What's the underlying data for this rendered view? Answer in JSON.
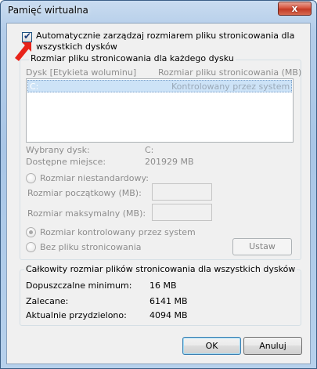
{
  "window": {
    "title": "Pamięć wirtualna",
    "close_label": "x"
  },
  "auto_manage": {
    "label": "Automatycznie zarządzaj rozmiarem pliku stronicowania dla wszystkich dysków",
    "checked": true
  },
  "per_drive": {
    "group_title": "Rozmiar pliku stronicowania dla każdego dysku",
    "col_drive": "Dysk [Etykieta woluminu]",
    "col_size": "Rozmiar pliku stronicowania (MB)",
    "rows": [
      {
        "drive": "C:",
        "size": "Kontrolowany przez system"
      }
    ],
    "selected_drive_label": "Wybrany dysk:",
    "selected_drive_value": "C:",
    "free_space_label": "Dostępne miejsce:",
    "free_space_value": "201929  MB",
    "custom_size_label": "Rozmiar niestandardowy:",
    "initial_size_label": "Rozmiar początkowy (MB):",
    "max_size_label": "Rozmiar maksymalny (MB):",
    "system_managed_label": "Rozmiar kontrolowany przez system",
    "no_paging_label": "Bez pliku stronicowania",
    "set_button": "Ustaw"
  },
  "totals": {
    "group_title": "Całkowity rozmiar plików stronicowania dla wszystkich dysków",
    "min_label": "Dopuszczalne minimum:",
    "min_value": "16  MB",
    "recommended_label": "Zalecane:",
    "recommended_value": "6141  MB",
    "allocated_label": "Aktualnie przydzielono:",
    "allocated_value": "4094  MB"
  },
  "buttons": {
    "ok": "OK",
    "cancel": "Anuluj"
  },
  "colors": {
    "annotation_arrow": "#e8231a"
  }
}
